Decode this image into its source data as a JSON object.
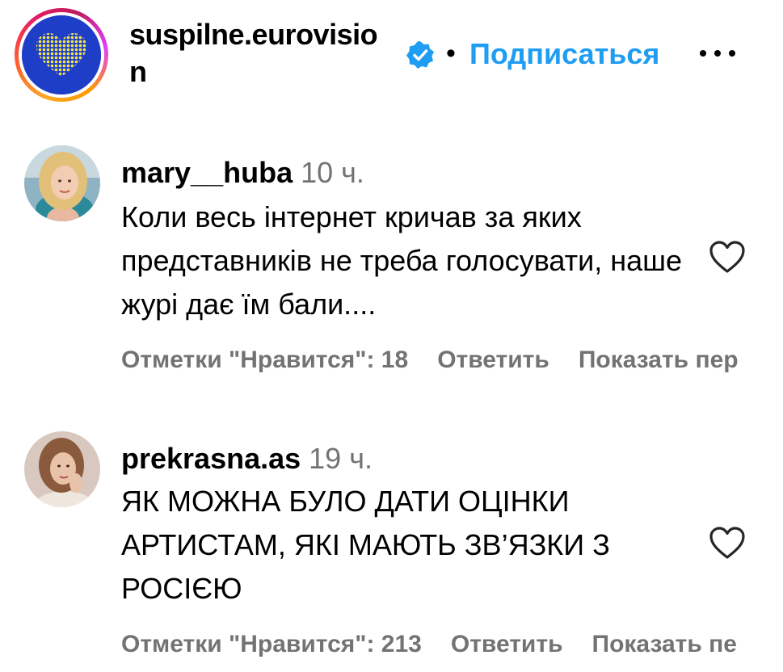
{
  "post": {
    "author": "suspilne.eurovision",
    "verified": true,
    "separator": "•",
    "follow_label": "Подписаться",
    "more_icon": "more-horizontal-icon",
    "accent_color": "#1e9df2",
    "brand_colors": {
      "avatar_bg": "#1e3ec8",
      "heart": "#f5e642"
    }
  },
  "comments": [
    {
      "username": "mary__huba",
      "time": "10 ч.",
      "text": "Коли весь інтернет кричав за яких представників не треба голосувати, наше журі дає їм бали....",
      "like_icon": "heart-outline-icon",
      "likes_label": "Отметки \"Нравится\": 18",
      "reply_label": "Ответить",
      "show_label": "Показать пер"
    },
    {
      "username": "prekrasna.as",
      "time": "19 ч.",
      "text": "ЯК МОЖНА БУЛО ДАТИ ОЦІНКИ АРТИСТАМ, ЯКІ МАЮТЬ ЗВ’ЯЗКИ З РОСІЄЮ",
      "like_icon": "heart-outline-icon",
      "likes_label": "Отметки \"Нравится\": 213",
      "reply_label": "Ответить",
      "show_label": "Показать пе"
    }
  ]
}
